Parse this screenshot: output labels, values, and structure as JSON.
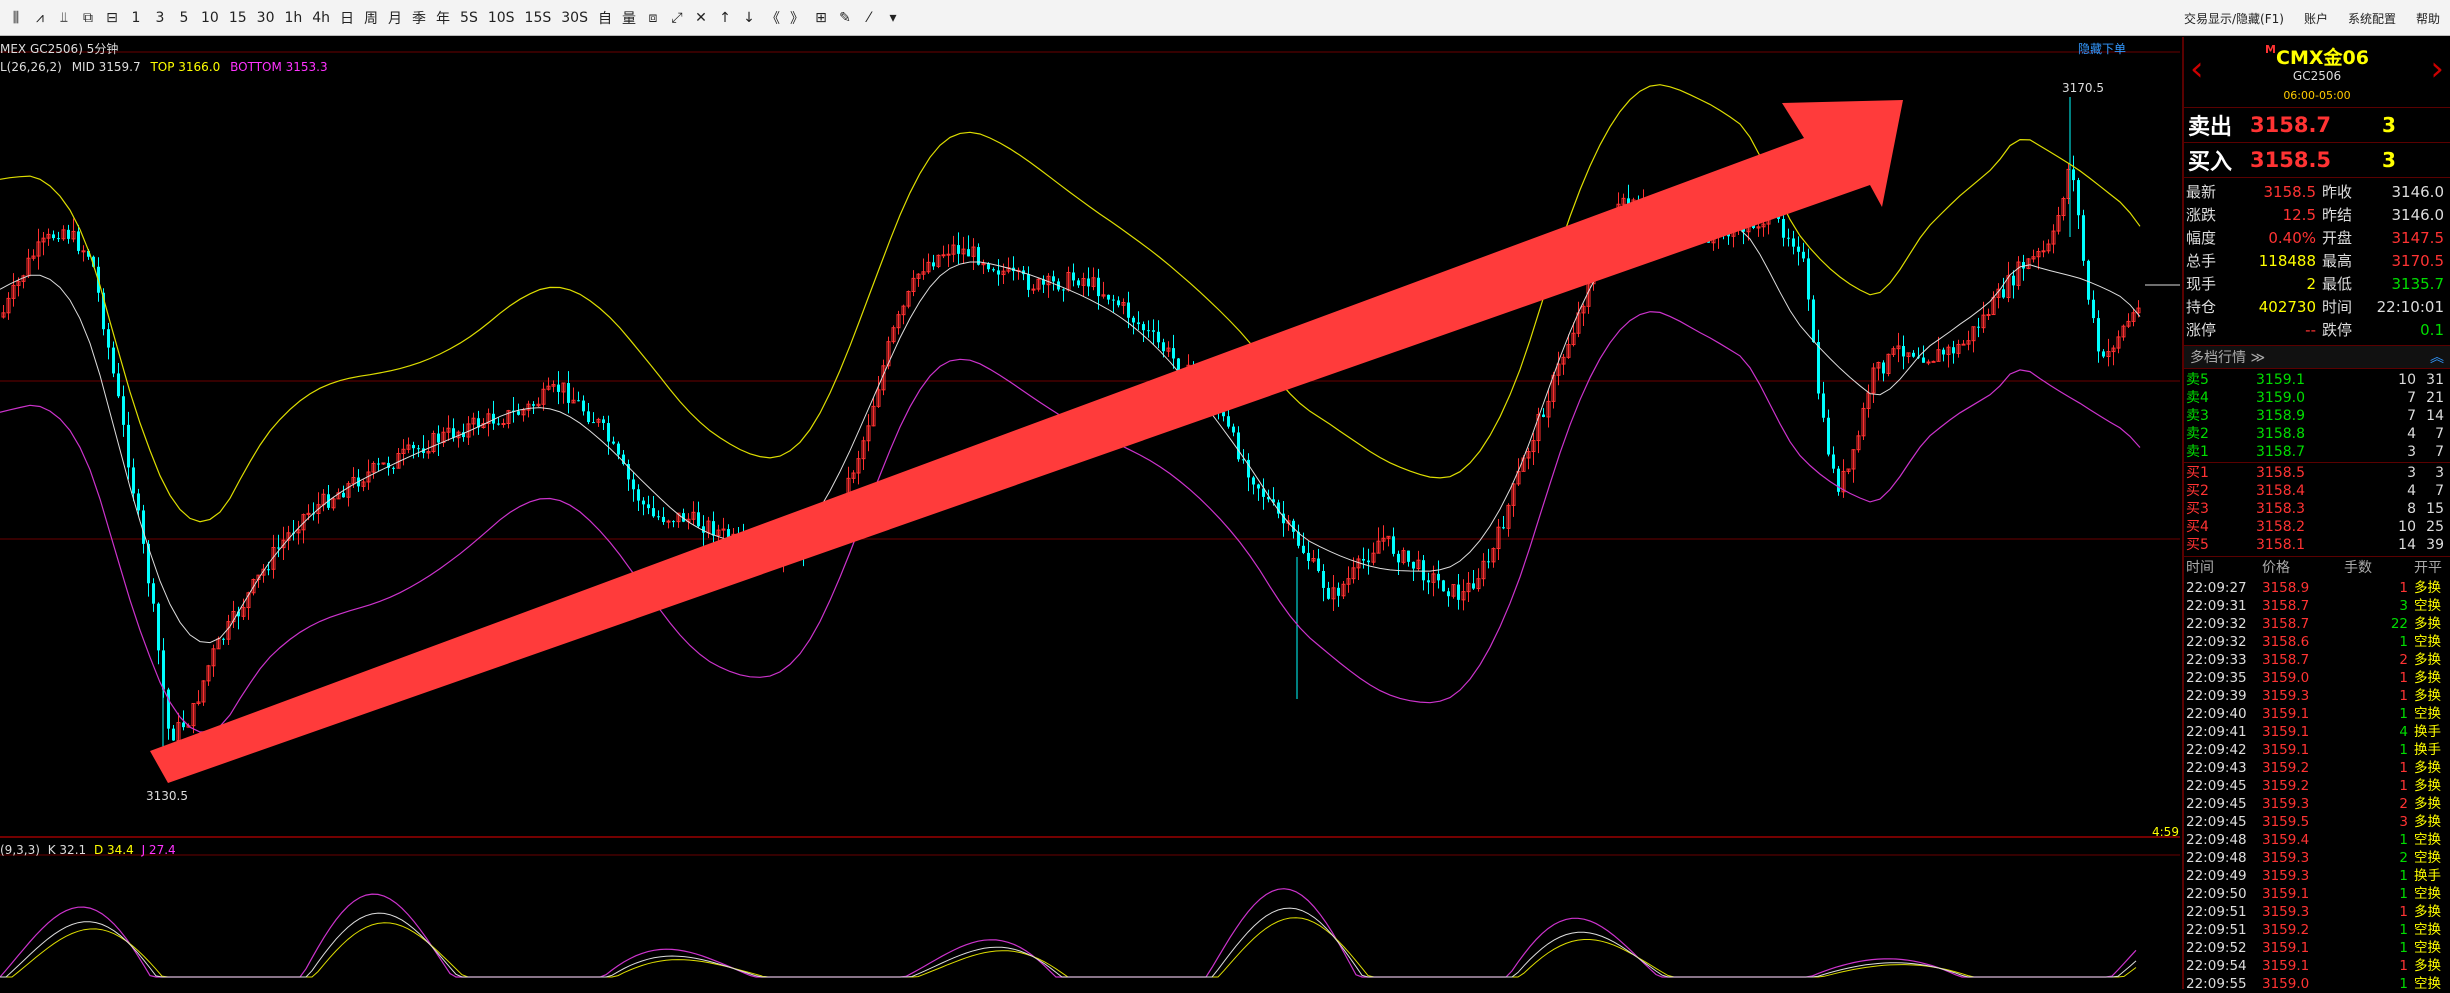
{
  "toolbar": {
    "icons": [
      "bars-chart-icon",
      "line-chart-icon",
      "kline-icon",
      "restore-icon",
      "save-icon",
      "1",
      "3",
      "5",
      "10",
      "15",
      "30",
      "1h",
      "4h",
      "日",
      "周",
      "月",
      "季",
      "年",
      "5S",
      "10S",
      "15S",
      "30S",
      "自",
      "量",
      "monitor-icon",
      "expand-icon",
      "crosshair-icon",
      "up-arrow-icon",
      "down-arrow-icon",
      "double-left-icon",
      "double-right-icon",
      "grid-icon",
      "pen-icon",
      "draw-line-icon",
      "dropdown-icon"
    ],
    "icon_labels": [
      "⫼",
      "⩘",
      "⫫",
      "⧉",
      "⊟",
      "1",
      "3",
      "5",
      "10",
      "15",
      "30",
      "1h",
      "4h",
      "日",
      "周",
      "月",
      "季",
      "年",
      "5S",
      "10S",
      "15S",
      "30S",
      "自",
      "量",
      "⧈",
      "⤢",
      "✕",
      "↑",
      "↓",
      "《",
      "》",
      "⊞",
      "✎",
      "⁄",
      "▾"
    ],
    "right_links": [
      "交易显示/隐藏(F1)",
      "账户",
      "系统配置",
      "帮助"
    ]
  },
  "main": {
    "chart_title": "MEX GC2506) 5分钟",
    "hide_order": "隐藏下单",
    "boll_label": "L(26,26,2)",
    "boll_mid": "MID 3159.7",
    "boll_top": "TOP 3166.0",
    "boll_bottom": "BOTTOM 3153.3",
    "high_marker": "3170.5",
    "low_marker": "3130.5",
    "countdown": "4:59",
    "kdj_label": "(9,3,3)",
    "kdj_k": "K 32.1",
    "kdj_d": "D 34.4",
    "kdj_j": "J 27.4"
  },
  "panel": {
    "m_mark": "M",
    "title": "CMX金06",
    "code": "GC2506",
    "session": "06:00-05:00",
    "prev": "‹",
    "next": "›",
    "ask_label": "卖出",
    "ask_price": "3158.7",
    "ask_qty": "3",
    "bid_label": "买入",
    "bid_price": "3158.5",
    "bid_qty": "3",
    "quote": [
      [
        "最新",
        "3158.5",
        "red",
        "昨收",
        "3146.0",
        "wht"
      ],
      [
        "涨跌",
        "12.5",
        "red",
        "昨结",
        "3146.0",
        "wht"
      ],
      [
        "幅度",
        "0.40%",
        "red",
        "开盘",
        "3147.5",
        "red"
      ],
      [
        "总手",
        "118488",
        "yel",
        "最高",
        "3170.5",
        "red"
      ],
      [
        "现手",
        "2",
        "yel",
        "最低",
        "3135.7",
        "grn"
      ],
      [
        "持仓",
        "402730",
        "yel",
        "时间",
        "22:10:01",
        "wht"
      ],
      [
        "涨停",
        "--",
        "red",
        "跌停",
        "0.1",
        "grn"
      ]
    ],
    "depth_header": "多档行情 ≫",
    "depth_collapse": "︽",
    "asks": [
      [
        "卖5",
        "3159.1",
        "10",
        "31"
      ],
      [
        "卖4",
        "3159.0",
        "7",
        "21"
      ],
      [
        "卖3",
        "3158.9",
        "7",
        "14"
      ],
      [
        "卖2",
        "3158.8",
        "4",
        "7"
      ],
      [
        "卖1",
        "3158.7",
        "3",
        "7"
      ]
    ],
    "bids": [
      [
        "买1",
        "3158.5",
        "3",
        "3"
      ],
      [
        "买2",
        "3158.4",
        "4",
        "7"
      ],
      [
        "买3",
        "3158.3",
        "8",
        "15"
      ],
      [
        "买4",
        "3158.2",
        "10",
        "25"
      ],
      [
        "买5",
        "3158.1",
        "14",
        "39"
      ]
    ],
    "trade_header": [
      "时间",
      "价格",
      "手数",
      "开平"
    ],
    "trades": [
      [
        "22:09:27",
        "3158.9",
        "1",
        "red",
        "多换"
      ],
      [
        "22:09:31",
        "3158.7",
        "3",
        "grn",
        "空换"
      ],
      [
        "22:09:32",
        "3158.7",
        "22",
        "grn",
        "多换"
      ],
      [
        "22:09:32",
        "3158.6",
        "1",
        "grn",
        "空换"
      ],
      [
        "22:09:33",
        "3158.7",
        "2",
        "red",
        "多换"
      ],
      [
        "22:09:35",
        "3159.0",
        "1",
        "red",
        "多换"
      ],
      [
        "22:09:39",
        "3159.3",
        "1",
        "red",
        "多换"
      ],
      [
        "22:09:40",
        "3159.1",
        "1",
        "grn",
        "空换"
      ],
      [
        "22:09:41",
        "3159.1",
        "4",
        "grn",
        "换手"
      ],
      [
        "22:09:42",
        "3159.1",
        "1",
        "grn",
        "换手"
      ],
      [
        "22:09:43",
        "3159.2",
        "1",
        "red",
        "多换"
      ],
      [
        "22:09:45",
        "3159.2",
        "1",
        "red",
        "多换"
      ],
      [
        "22:09:45",
        "3159.3",
        "2",
        "red",
        "多换"
      ],
      [
        "22:09:45",
        "3159.5",
        "3",
        "red",
        "多换"
      ],
      [
        "22:09:48",
        "3159.4",
        "1",
        "grn",
        "空换"
      ],
      [
        "22:09:48",
        "3159.3",
        "2",
        "grn",
        "空换"
      ],
      [
        "22:09:49",
        "3159.3",
        "1",
        "grn",
        "换手"
      ],
      [
        "22:09:50",
        "3159.1",
        "1",
        "grn",
        "空换"
      ],
      [
        "22:09:51",
        "3159.3",
        "1",
        "red",
        "多换"
      ],
      [
        "22:09:51",
        "3159.2",
        "1",
        "grn",
        "空换"
      ],
      [
        "22:09:52",
        "3159.1",
        "1",
        "grn",
        "空换"
      ],
      [
        "22:09:54",
        "3159.1",
        "1",
        "red",
        "多换"
      ],
      [
        "22:09:55",
        "3159.0",
        "1",
        "grn",
        "空换"
      ]
    ]
  }
}
